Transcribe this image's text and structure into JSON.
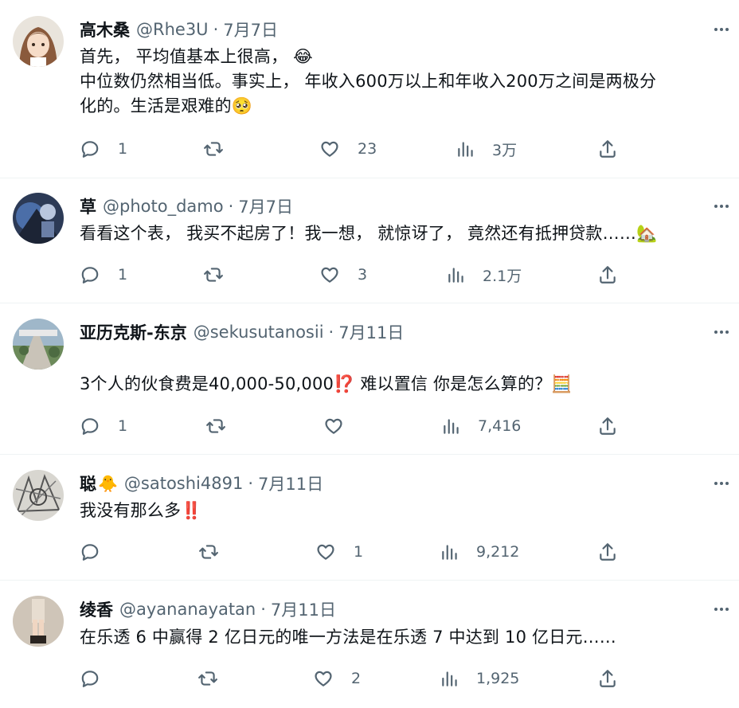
{
  "tweets": [
    {
      "name": "高木桑",
      "handle": "@Rhe3U",
      "date": "7月7日",
      "lines": [
        "首先，  平均值基本上很高， 😂",
        "中位数仍然相当低。事实上， 年收入600万以上和年收入200万之间是两极分",
        "化的。生活是艰难的🥺"
      ],
      "replies": "1",
      "retweets": "",
      "likes": "23",
      "views": "3万"
    },
    {
      "name": "草",
      "handle": "@photo_damo",
      "date": "7月7日",
      "lines": [
        "看看这个表， 我买不起房了！我一想， 就惊讶了， 竟然还有抵押贷款……🏡"
      ],
      "replies": "1",
      "retweets": "",
      "likes": "3",
      "views": "2.1万"
    },
    {
      "name": "亚历克斯-东京",
      "handle": "@sekusutanosii",
      "date": "7月11日",
      "lines": [
        "3个人的伙食费是40,000-50,000⁉️ 难以置信 你是怎么算的？🧮"
      ],
      "replies": "1",
      "retweets": "",
      "likes": "",
      "views": "7,416"
    },
    {
      "name": "聪",
      "name_emoji": "🐥",
      "handle": "@satoshi4891",
      "date": "7月11日",
      "lines": [
        "我没有那么多‼️"
      ],
      "replies": "",
      "retweets": "",
      "likes": "1",
      "views": "9,212"
    },
    {
      "name": "绫香",
      "handle": "@ayananayatan",
      "date": "7月11日",
      "lines": [
        "在乐透 6 中赢得 2 亿日元的唯一方法是在乐透 7 中达到 10 亿日元……"
      ],
      "replies": "",
      "retweets": "",
      "likes": "2",
      "views": "1,925"
    }
  ],
  "ui": {
    "separator": "·",
    "icons": [
      "reply-icon",
      "retweet-icon",
      "like-icon",
      "views-icon",
      "share-icon",
      "more-icon"
    ],
    "colors": {
      "text": "#0f1419",
      "secondary": "#536471",
      "divider": "#eff3f4"
    }
  }
}
